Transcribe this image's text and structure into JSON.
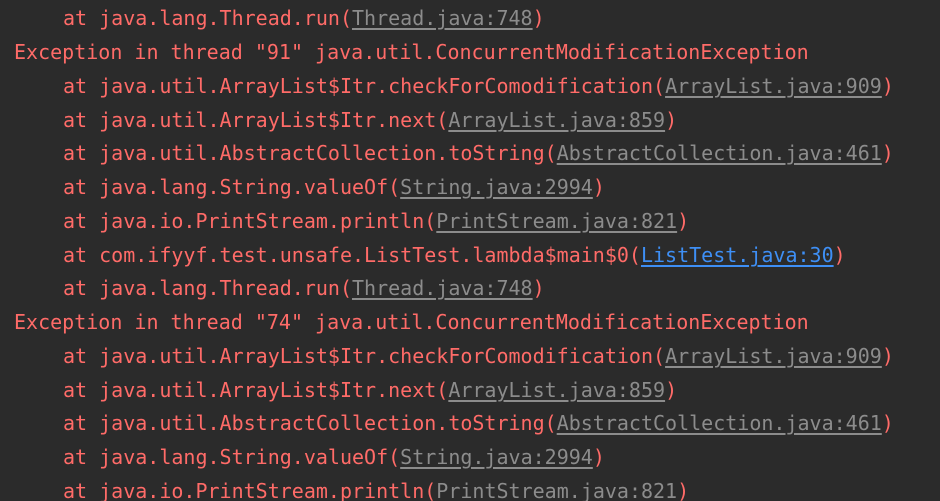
{
  "console": {
    "lines": [
      {
        "type": "frame",
        "prefix": "at java.lang.Thread.run(",
        "link": "Thread.java:748",
        "suffix": ")",
        "link_kind": "library"
      },
      {
        "type": "exception",
        "text": "Exception in thread \"91\" java.util.ConcurrentModificationException"
      },
      {
        "type": "frame",
        "prefix": "at java.util.ArrayList$Itr.checkForComodification(",
        "link": "ArrayList.java:909",
        "suffix": ")",
        "link_kind": "library"
      },
      {
        "type": "frame",
        "prefix": "at java.util.ArrayList$Itr.next(",
        "link": "ArrayList.java:859",
        "suffix": ")",
        "link_kind": "library"
      },
      {
        "type": "frame",
        "prefix": "at java.util.AbstractCollection.toString(",
        "link": "AbstractCollection.java:461",
        "suffix": ")",
        "link_kind": "library"
      },
      {
        "type": "frame",
        "prefix": "at java.lang.String.valueOf(",
        "link": "String.java:2994",
        "suffix": ")",
        "link_kind": "library"
      },
      {
        "type": "frame",
        "prefix": "at java.io.PrintStream.println(",
        "link": "PrintStream.java:821",
        "suffix": ")",
        "link_kind": "library"
      },
      {
        "type": "frame",
        "prefix": "at com.ifyyf.test.unsafe.ListTest.lambda$main$0(",
        "link": "ListTest.java:30",
        "suffix": ")",
        "link_kind": "user"
      },
      {
        "type": "frame",
        "prefix": "at java.lang.Thread.run(",
        "link": "Thread.java:748",
        "suffix": ")",
        "link_kind": "library"
      },
      {
        "type": "exception",
        "text": "Exception in thread \"74\" java.util.ConcurrentModificationException"
      },
      {
        "type": "frame",
        "prefix": "at java.util.ArrayList$Itr.checkForComodification(",
        "link": "ArrayList.java:909",
        "suffix": ")",
        "link_kind": "library"
      },
      {
        "type": "frame",
        "prefix": "at java.util.ArrayList$Itr.next(",
        "link": "ArrayList.java:859",
        "suffix": ")",
        "link_kind": "library"
      },
      {
        "type": "frame",
        "prefix": "at java.util.AbstractCollection.toString(",
        "link": "AbstractCollection.java:461",
        "suffix": ")",
        "link_kind": "library"
      },
      {
        "type": "frame",
        "prefix": "at java.lang.String.valueOf(",
        "link": "String.java:2994",
        "suffix": ")",
        "link_kind": "library"
      },
      {
        "type": "frame",
        "prefix": "at java.io.PrintStream.println(",
        "link": "PrintStream.java:821",
        "suffix": ")",
        "link_kind": "library"
      }
    ]
  },
  "colors": {
    "background": "#2b2b2b",
    "error_text": "#ff6b68",
    "library_link": "#8c8c8c",
    "user_link": "#3e8ff5"
  }
}
